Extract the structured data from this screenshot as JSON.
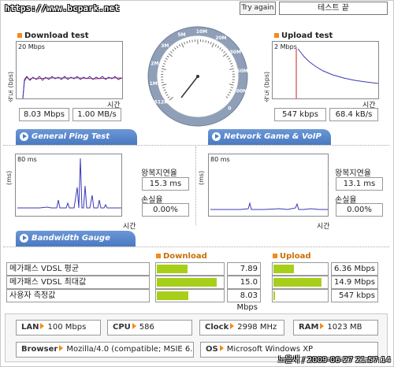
{
  "header": {
    "url": "https://www.bcpark.net",
    "try_again": "Try again",
    "status": "테스트 끝"
  },
  "download": {
    "title": "Download test",
    "ylabel": "속도 (bps)",
    "scale": "20 Mbps",
    "xlabel": "시간",
    "mbps": "8.03 Mbps",
    "mbs": "1.00 MB/s"
  },
  "upload": {
    "title": "Upload test",
    "ylabel": "속도 (bps)",
    "scale": "2 Mbps",
    "xlabel": "시간",
    "kbps": "547 kbps",
    "kbs": "68.4 kB/s"
  },
  "gauge": {
    "labels": [
      "512K",
      "1M",
      "2M",
      "3M",
      "5M",
      "10M",
      "20M",
      "30M",
      "50M",
      "100M",
      "0"
    ]
  },
  "tabs": {
    "ping": "General Ping Test",
    "game": "Network Game & VoIP Test",
    "bandwidth": "Bandwidth Gauge"
  },
  "ping_left": {
    "ylabel": "(ms)",
    "scale": "80 ms",
    "xlabel": "시간",
    "rtt_label": "왕복지연율",
    "rtt": "15.3 ms",
    "loss_label": "손실율",
    "loss": "0.00%"
  },
  "ping_right": {
    "ylabel": "(ms)",
    "scale": "80 ms",
    "xlabel": "시간",
    "rtt_label": "왕복지연율",
    "rtt": "13.1 ms",
    "loss_label": "손실율",
    "loss": "0.00%"
  },
  "bandwidth": {
    "download_head": "Download",
    "upload_head": "Upload",
    "rows": [
      {
        "label": "메가패스 VDSL 평균",
        "down": "7.89 Mbps",
        "down_fill": 0.47,
        "up": "6.36 Mbps",
        "up_fill": 0.38
      },
      {
        "label": "메가패스 VDSL 최대값",
        "down": "15.0 Mbps",
        "down_fill": 0.9,
        "up": "14.9 Mbps",
        "up_fill": 0.9
      },
      {
        "label": "사용자 측정값",
        "down": "8.03 Mbps",
        "down_fill": 0.48,
        "up": "547 kbps",
        "up_fill": 0.03
      }
    ]
  },
  "info": {
    "lan_k": "LAN",
    "lan_v": "100 Mbps",
    "cpu_k": "CPU",
    "cpu_v": "586",
    "clock_k": "Clock",
    "clock_v": "2998 MHz",
    "ram_k": "RAM",
    "ram_v": "1023 MB",
    "browser_k": "Browser",
    "browser_v": "Mozilla/4.0 (compatible; MSIE 6.0",
    "os_k": "OS",
    "os_v": "Microsoft Windows XP"
  },
  "footer": {
    "stamp": "노을새 / 2009-06-27 21:57:14"
  },
  "colors": {
    "accent": "#f28a1e",
    "bar": "#a7cf1a",
    "tab": "#4a79c1",
    "line": "#3a3ab8",
    "red": "#d02020"
  }
}
